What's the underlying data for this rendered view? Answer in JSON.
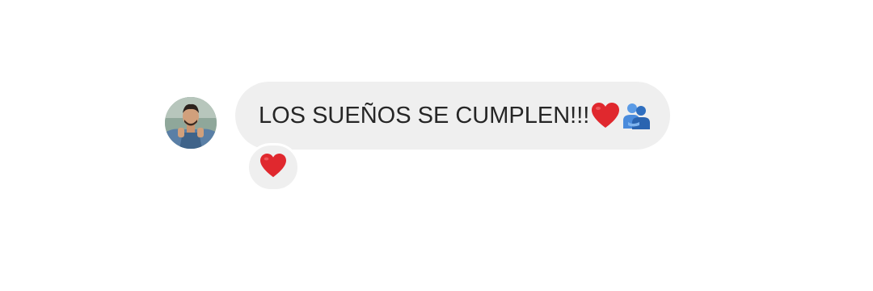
{
  "message": {
    "text": "LOS SUEÑOS SE CUMPLEN!!!",
    "trailing_emojis": [
      "red-heart-emoji",
      "people-hugging-emoji"
    ]
  },
  "sender": {
    "avatar": "profile-photo"
  },
  "reaction": {
    "emoji": "red-heart-emoji"
  },
  "colors": {
    "bubble_background": "#efefef",
    "text": "#262626",
    "heart": "#e0282e",
    "people": "#3a82d6",
    "page_background": "#ffffff"
  }
}
